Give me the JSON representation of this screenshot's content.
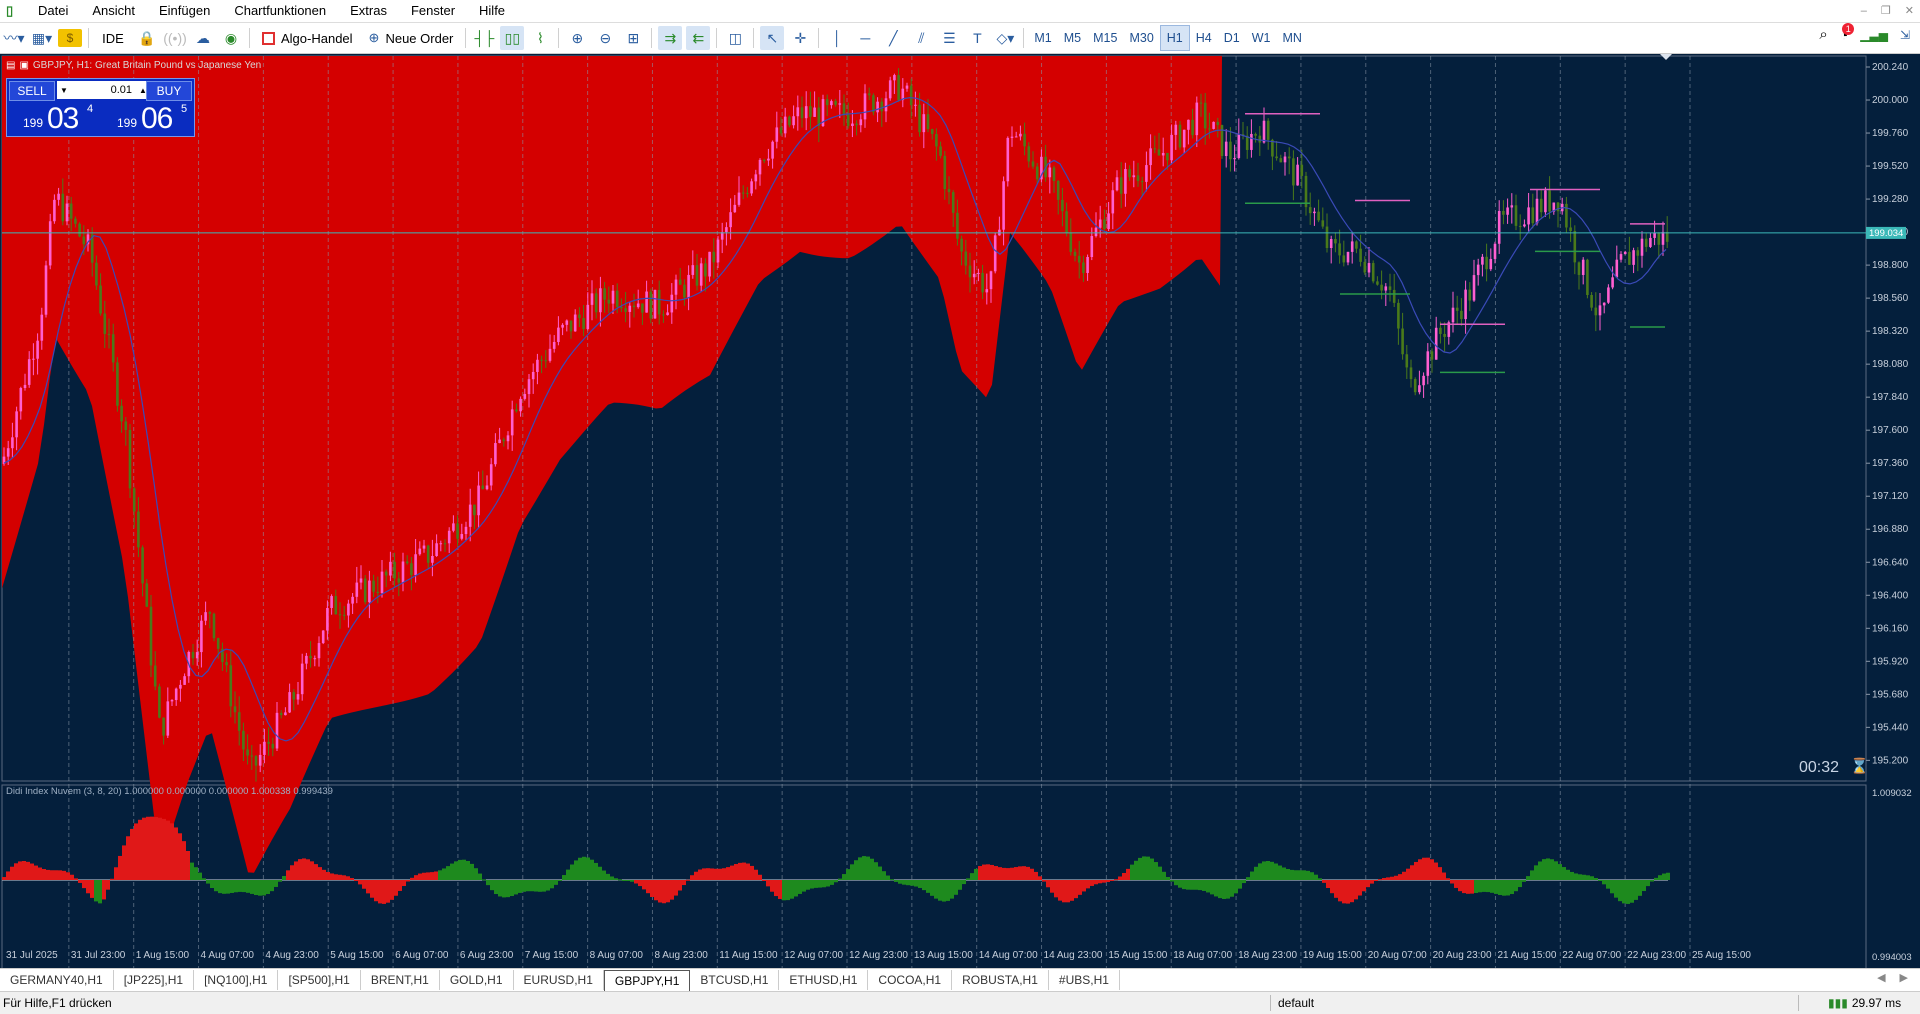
{
  "menu": [
    "Datei",
    "Ansicht",
    "Einfügen",
    "Chartfunktionen",
    "Extras",
    "Fenster",
    "Hilfe"
  ],
  "toolbar": {
    "ide": "IDE",
    "algo": "Algo-Handel",
    "new_order": "Neue Order",
    "timeframes": [
      "M1",
      "M5",
      "M15",
      "M30",
      "H1",
      "H4",
      "D1",
      "W1",
      "MN"
    ],
    "active_tf": "H1",
    "notification_count": "1"
  },
  "chart": {
    "symbol_label": "GBPJPY, H1:  Great Britain Pound vs Japanese Yen",
    "current_price": "199.034",
    "countdown": "00:32",
    "price_ticks": [
      "200.240",
      "200.000",
      "199.760",
      "199.520",
      "199.280",
      "199.040",
      "198.800",
      "198.560",
      "198.320",
      "198.080",
      "197.840",
      "197.600",
      "197.360",
      "197.120",
      "196.880",
      "196.640",
      "196.400",
      "196.160",
      "195.920",
      "195.680",
      "195.440",
      "195.200"
    ],
    "time_ticks": [
      "31 Jul 2025",
      "31 Jul 23:00",
      "1 Aug 15:00",
      "4 Aug 07:00",
      "4 Aug 23:00",
      "5 Aug 15:00",
      "6 Aug 07:00",
      "6 Aug 23:00",
      "7 Aug 15:00",
      "8 Aug 07:00",
      "8 Aug 23:00",
      "11 Aug 15:00",
      "12 Aug 07:00",
      "12 Aug 23:00",
      "13 Aug 15:00",
      "14 Aug 07:00",
      "14 Aug 23:00",
      "15 Aug 15:00",
      "18 Aug 07:00",
      "18 Aug 23:00",
      "19 Aug 15:00",
      "20 Aug 07:00",
      "20 Aug 23:00",
      "21 Aug 15:00",
      "22 Aug 07:00",
      "22 Aug 23:00",
      "25 Aug 15:00"
    ],
    "colors": {
      "bg": "#041f3c",
      "cloud": "#d40000",
      "bull": "#ff5fd0",
      "bear": "#4a7a1a",
      "ma": "#3a4ab8",
      "price_line": "#3bb8b8"
    }
  },
  "trade_panel": {
    "sell_label": "SELL",
    "buy_label": "BUY",
    "lot": "0.01",
    "sell_small": "199",
    "sell_big": "03",
    "sell_sup": "4",
    "buy_small": "199",
    "buy_big": "06",
    "buy_sup": "5"
  },
  "indicator": {
    "label": "Didi Index Nuvem (3, 8, 20) 1.000000 0.000000 0.000000 1.000338 0.999439",
    "ticks": [
      "1.009032",
      "0.994003"
    ]
  },
  "tabs": [
    "GERMANY40,H1",
    "[JP225],H1",
    "[NQ100],H1",
    "[SP500],H1",
    "BRENT,H1",
    "GOLD,H1",
    "EURUSD,H1",
    "GBPJPY,H1",
    "BTCUSD,H1",
    "ETHUSD,H1",
    "COCOA,H1",
    "ROBUSTA,H1",
    "#UBS,H1"
  ],
  "active_tab": "GBPJPY,H1",
  "status": {
    "help": "Für Hilfe,F1 drücken",
    "profile": "default",
    "connection": "29.97 ms"
  }
}
